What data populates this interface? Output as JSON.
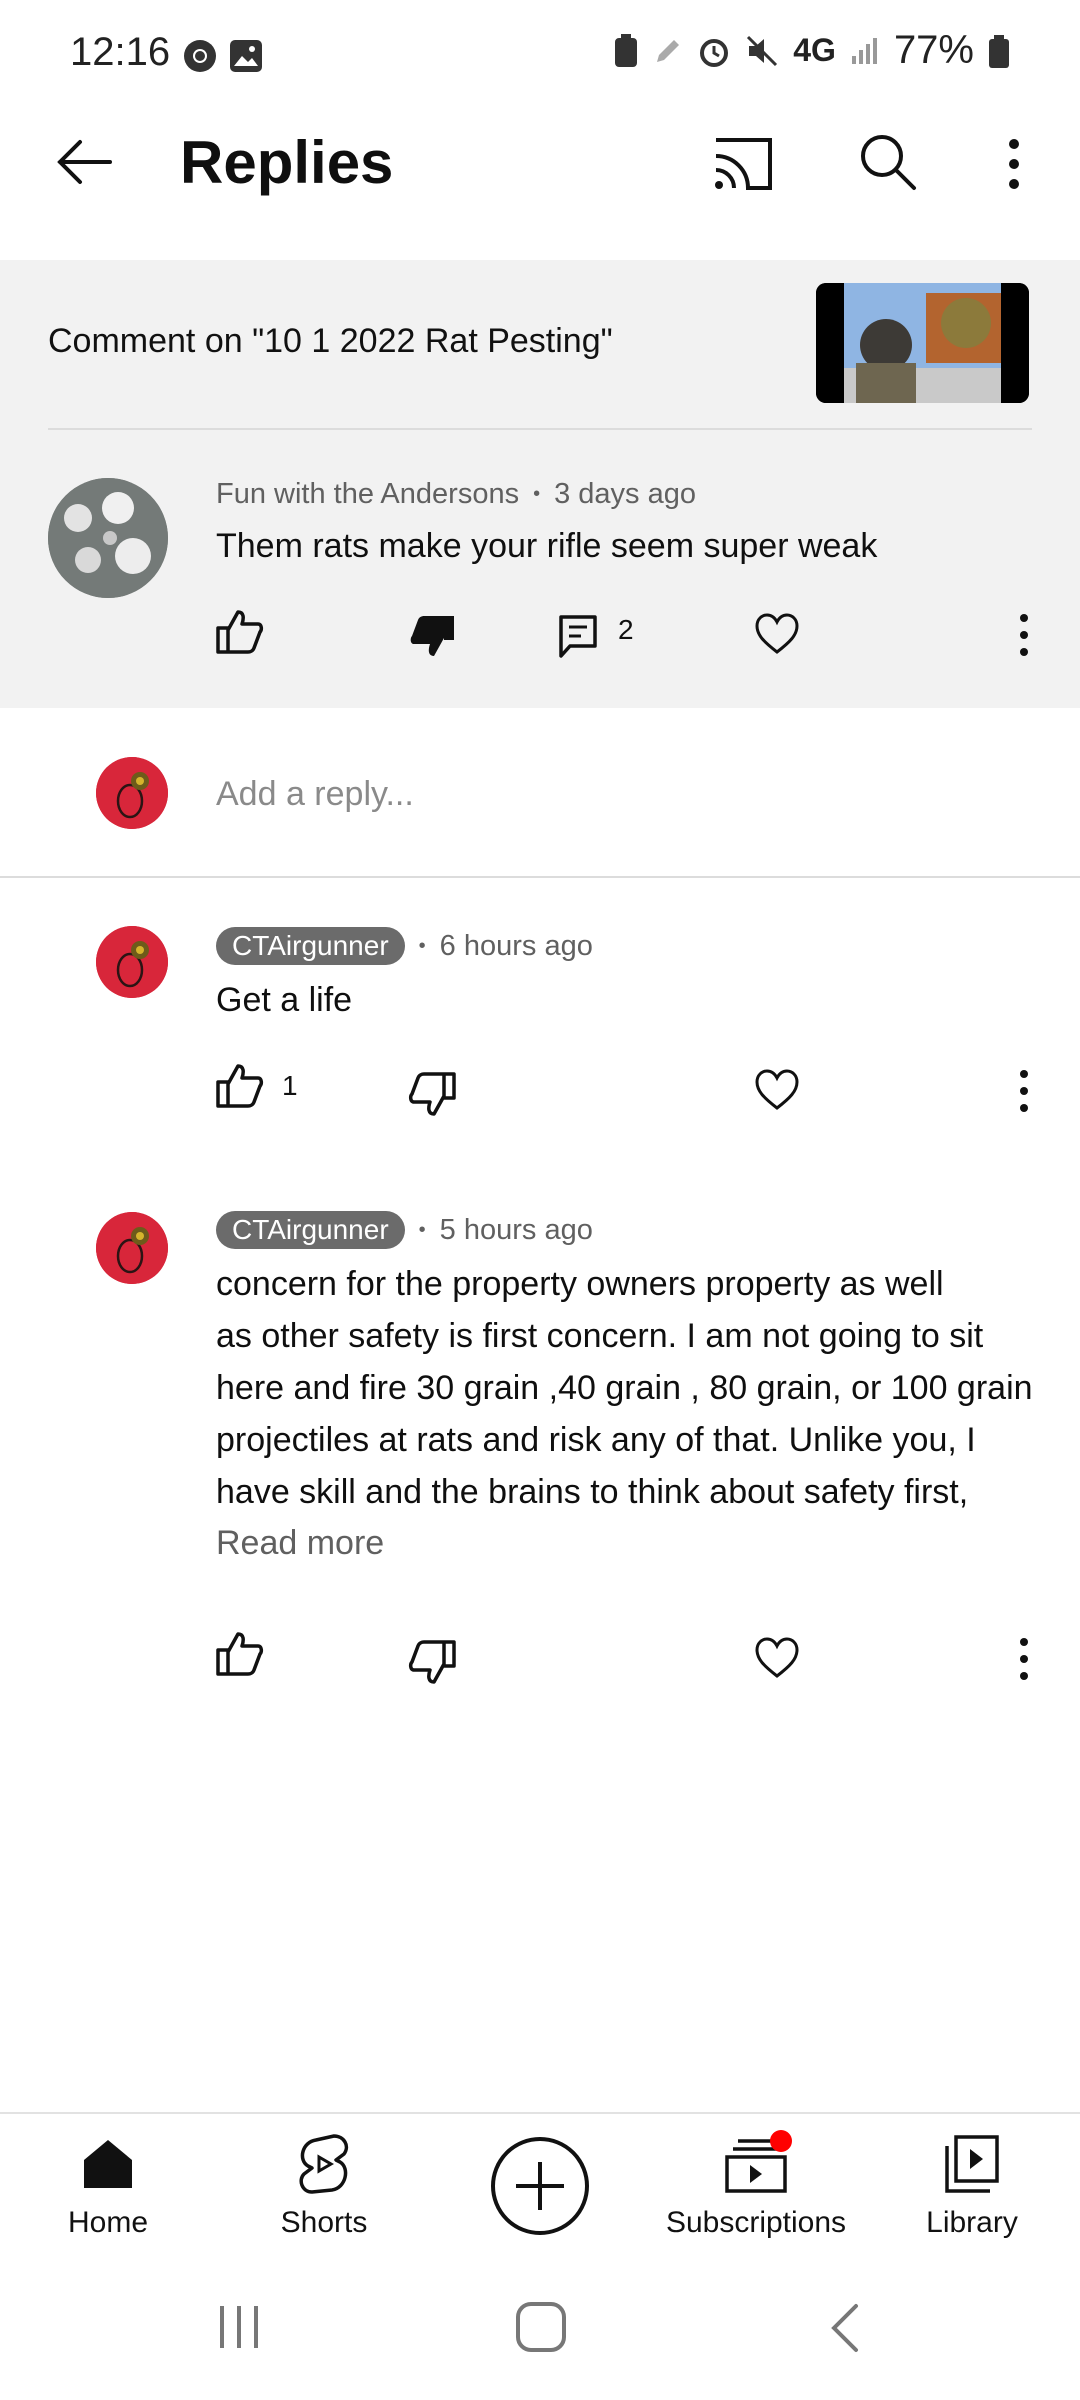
{
  "status_bar": {
    "time": "12:16",
    "network": "4G",
    "battery": "77%"
  },
  "header": {
    "title": "Replies",
    "icons": [
      "back-arrow-icon",
      "cast-icon",
      "search-icon",
      "more-vert-icon"
    ]
  },
  "parent": {
    "comment_on": "Comment on \"10 1 2022 Rat Pesting\"",
    "author": "Fun with the Andersons",
    "time": "3 days ago",
    "text": "Them rats make your rifle seem super weak",
    "reply_count": "2"
  },
  "reply_box": {
    "placeholder": "Add a reply..."
  },
  "replies": [
    {
      "author": "CTAirgunner",
      "time": "6 hours ago",
      "text": "Get a life",
      "likes": "1"
    },
    {
      "author": "CTAirgunner",
      "time": "5 hours ago",
      "lines": [
        "concern for the property owners property as well",
        "as other safety is first concern. I am not going to sit",
        "here and fire 30 grain ,40 grain , 80 grain, or 100 grain",
        "projectiles at rats and risk any of that.  Unlike you, I",
        "have skill and the brains to think about safety first,"
      ],
      "read_more": "Read more"
    }
  ],
  "bottom_nav": {
    "home": "Home",
    "shorts": "Shorts",
    "subscriptions": "Subscriptions",
    "library": "Library"
  },
  "colors": {
    "accent": "#ff0000",
    "chip": "#6b6b6b",
    "avatar_red": "#d8263a",
    "parent_bg": "#f2f2f2"
  }
}
